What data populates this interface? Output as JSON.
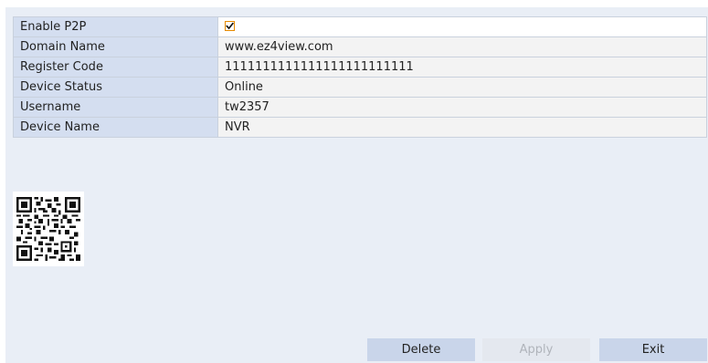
{
  "form": {
    "rows": [
      {
        "label": "Enable P2P",
        "checked": true
      },
      {
        "label": "Domain Name",
        "value": "www.ez4view.com"
      },
      {
        "label": "Register Code",
        "value": "1111111111111111111111111"
      },
      {
        "label": "Device Status",
        "value": "Online"
      },
      {
        "label": "Username",
        "value": "tw2357"
      },
      {
        "label": "Device Name",
        "value": "NVR"
      }
    ]
  },
  "buttons": {
    "delete": "Delete",
    "apply": "Apply",
    "exit": "Exit"
  },
  "colors": {
    "panel_bg": "#e9eef6",
    "label_bg": "#d4def0",
    "checkbox_accent": "#e68a00",
    "button_bg": "#c9d5ea"
  },
  "icons": {
    "qr": "qr-code-icon",
    "check": "checkmark-icon"
  }
}
